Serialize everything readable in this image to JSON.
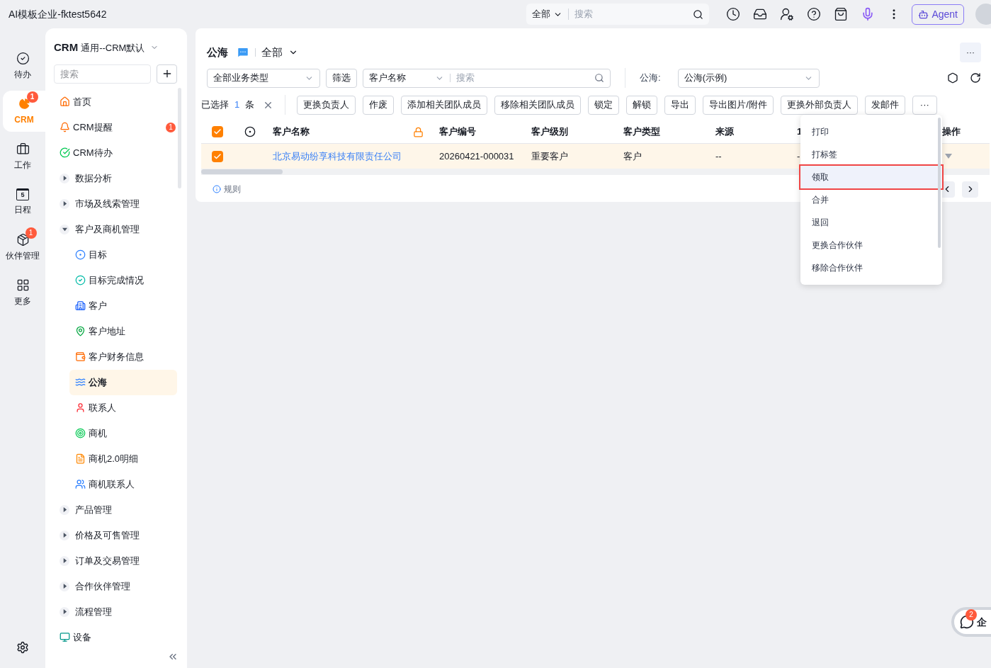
{
  "window": {
    "title": "AI模板企业-fktest5642"
  },
  "topbar": {
    "scope": "全部",
    "search_placeholder": "搜索",
    "agent": "Agent"
  },
  "rail": [
    {
      "label": "待办",
      "selected": false
    },
    {
      "label": "CRM",
      "selected": true,
      "badge": "1"
    },
    {
      "label": "工作",
      "selected": false
    },
    {
      "label": "日程",
      "selected": false,
      "day": "5"
    },
    {
      "label": "伙伴管理",
      "selected": false,
      "badge": "1"
    },
    {
      "label": "更多",
      "selected": false
    }
  ],
  "sidebar": {
    "title": "CRM",
    "subtitle": "通用--CRM默认",
    "search_placeholder": "搜索",
    "items": [
      {
        "kind": "link",
        "label": "首页",
        "selected": false
      },
      {
        "kind": "link",
        "label": "CRM提醒",
        "selected": false,
        "badge": "1"
      },
      {
        "kind": "link",
        "label": "CRM待办",
        "selected": false
      },
      {
        "kind": "group",
        "label": "数据分析",
        "expanded": false
      },
      {
        "kind": "group",
        "label": "市场及线索管理",
        "expanded": false
      },
      {
        "kind": "group",
        "label": "客户及商机管理",
        "expanded": true,
        "children": [
          {
            "label": "目标",
            "selected": false
          },
          {
            "label": "目标完成情况",
            "selected": false
          },
          {
            "label": "客户",
            "selected": false
          },
          {
            "label": "客户地址",
            "selected": false
          },
          {
            "label": "客户财务信息",
            "selected": false
          },
          {
            "label": "公海",
            "selected": true
          },
          {
            "label": "联系人",
            "selected": false
          },
          {
            "label": "商机",
            "selected": false
          },
          {
            "label": "商机2.0明细",
            "selected": false
          },
          {
            "label": "商机联系人",
            "selected": false
          }
        ]
      },
      {
        "kind": "group",
        "label": "产品管理",
        "expanded": false
      },
      {
        "kind": "group",
        "label": "价格及可售管理",
        "expanded": false
      },
      {
        "kind": "group",
        "label": "订单及交易管理",
        "expanded": false
      },
      {
        "kind": "group",
        "label": "合作伙伴管理",
        "expanded": false
      },
      {
        "kind": "group",
        "label": "流程管理",
        "expanded": false
      },
      {
        "kind": "link",
        "label": "设备",
        "selected": false
      }
    ]
  },
  "main": {
    "title": "公海",
    "view": "全部",
    "filters": {
      "business_type": "全部业务类型",
      "filter_button": "筛选",
      "field": "客户名称",
      "search_placeholder": "搜索",
      "pool_label": "公海:",
      "pool": "公海(示例)"
    },
    "selection": {
      "prefix": "已选择",
      "count": "1",
      "suffix": "条"
    },
    "actions": [
      "更换负责人",
      "作废",
      "添加相关团队成员",
      "移除相关团队成员",
      "锁定",
      "解锁",
      "导出",
      "导出图片/附件",
      "更换外部负责人",
      "发邮件"
    ],
    "more": "···",
    "table": {
      "all_selected": true,
      "columns": [
        "客户名称",
        "客户编号",
        "客户级别",
        "客户类型",
        "来源",
        "1",
        "操作"
      ],
      "rows": [
        {
          "selected": true,
          "cells": [
            "北京易动纷享科技有限责任公司",
            "20260421-000031",
            "重要客户",
            "客户",
            "--",
            "-"
          ]
        }
      ]
    },
    "rules": "规则",
    "menu": [
      {
        "label": "打印",
        "highlighted": false
      },
      {
        "label": "打标签",
        "highlighted": false
      },
      {
        "label": "领取",
        "highlighted": true
      },
      {
        "label": "合并",
        "highlighted": false
      },
      {
        "label": "退回",
        "highlighted": false
      },
      {
        "label": "更换合作伙伴",
        "highlighted": false
      },
      {
        "label": "移除合作伙伴",
        "highlighted": false
      }
    ]
  },
  "chat": {
    "badge": "2",
    "label": "企"
  }
}
